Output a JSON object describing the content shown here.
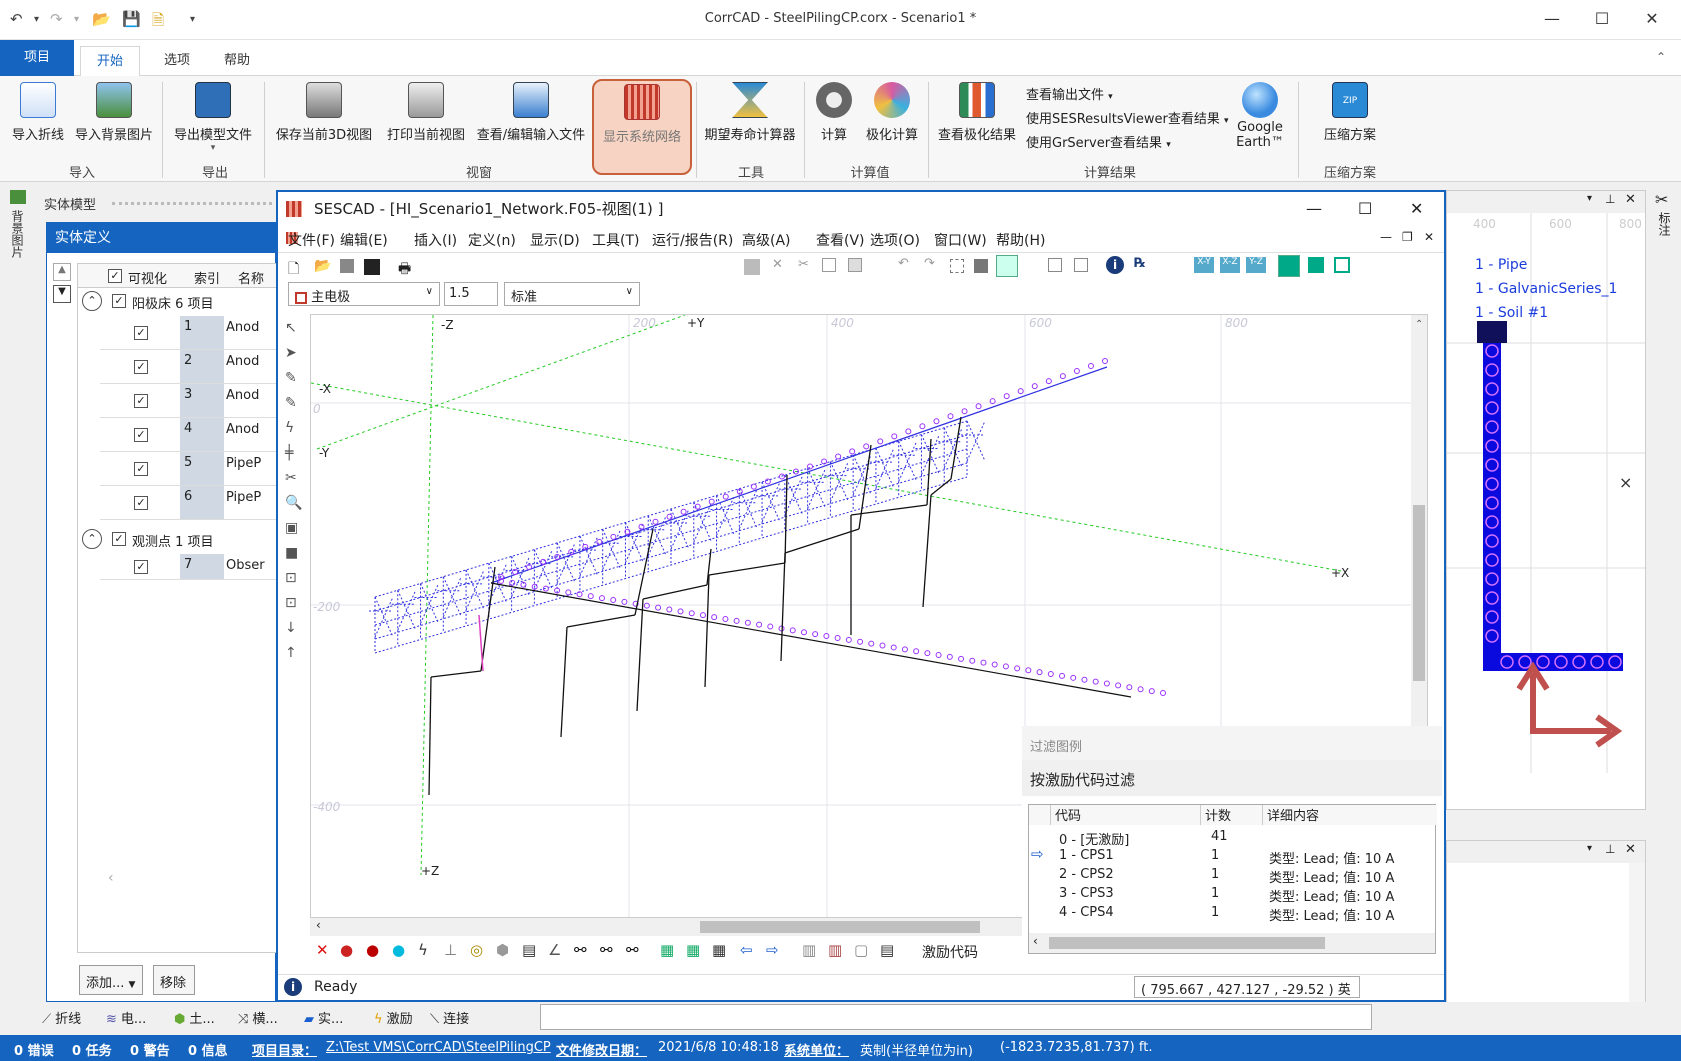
{
  "app": {
    "title": "CorrCAD - SteelPilingCP.corx - Scenario1 *",
    "qa_icons": [
      "undo-icon",
      "redo-icon",
      "open-icon",
      "save-icon",
      "saveas-icon",
      "customize-icon"
    ]
  },
  "tabs": [
    "项目",
    "开始",
    "选项",
    "帮助"
  ],
  "ribbon": {
    "buttons": [
      {
        "label": "导入折线",
        "icon": "import-polyline-icon",
        "color": "#3b7bd4"
      },
      {
        "label": "导入背景图片",
        "icon": "import-image-icon",
        "color": "#4a8f3c"
      },
      {
        "label": "导出模型文件",
        "icon": "export-model-icon",
        "color": "#2f6fb8"
      },
      {
        "label": "保存当前3D视图",
        "icon": "camera-icon",
        "color": "#666666"
      },
      {
        "label": "打印当前视图",
        "icon": "printer-icon",
        "color": "#777777"
      },
      {
        "label": "查看/编辑输入文件",
        "icon": "edit-file-icon",
        "color": "#3a7fd0"
      },
      {
        "label": "显示系统网络",
        "icon": "network-icon",
        "color": "#c0392b"
      },
      {
        "label": "期望寿命计算器",
        "icon": "hourglass-icon",
        "color": "#2a8ad6"
      },
      {
        "label": "计算",
        "icon": "gear-icon",
        "color": "#666666"
      },
      {
        "label": "极化计算",
        "icon": "polarize-icon",
        "color": "#d85aa0"
      },
      {
        "label": "查看极化结果",
        "icon": "chart-icon",
        "color": "#2e8b57"
      },
      {
        "label": "Google",
        "label2": "Earth™",
        "icon": "google-earth-icon",
        "color": "#3a8be0"
      },
      {
        "label": "压缩方案",
        "icon": "zip-icon",
        "color": "#2a8ad6"
      }
    ],
    "small": [
      "查看输出文件",
      "使用SESResultsViewer查看结果",
      "使用GrServer查看结果"
    ],
    "groups": [
      "导入",
      "导出",
      "视窗",
      "工具",
      "计算值",
      "计算结果",
      "压缩方案"
    ]
  },
  "entity": {
    "panel_title": "实体模型",
    "def_title": "实体定义",
    "cols": [
      "可视化",
      "索引",
      "名称"
    ],
    "group1": "阳极床 6 项目",
    "group2": "观测点 1 项目",
    "rows": [
      {
        "idx": "1",
        "name": "Anod"
      },
      {
        "idx": "2",
        "name": "Anod"
      },
      {
        "idx": "3",
        "name": "Anod"
      },
      {
        "idx": "4",
        "name": "Anod"
      },
      {
        "idx": "5",
        "name": "PipeP"
      },
      {
        "idx": "6",
        "name": "PipeP"
      }
    ],
    "obs": {
      "idx": "7",
      "name": "Obser"
    },
    "add": "添加...",
    "remove": "移除",
    "side_label": "背景图片"
  },
  "sescad": {
    "title": "SESCAD - [HI_Scenario1_Network.F05-视图(1) ]",
    "menu": [
      "文件(F)",
      "编辑(E)",
      "插入(I)",
      "定义(n)",
      "显示(D)",
      "工具(T)",
      "运行/报告(R)",
      "高级(A)",
      "查看(V)",
      "选项(O)",
      "窗口(W)",
      "帮助(H)"
    ],
    "electrode": "主电极",
    "value": "1.5",
    "mode": "标准",
    "axis_labels": [
      "-Z",
      "+Y",
      "-X",
      "-Y",
      "+X",
      "+Z",
      "0"
    ],
    "ticks_x": [
      "200",
      "400",
      "600",
      "800"
    ],
    "ticks_y": [
      "-200",
      "-400"
    ],
    "status_ready": "Ready",
    "coords": "( 795.667  , 427.127  ,  -29.52   ) 英",
    "excite_code": "激励代码"
  },
  "legend": {
    "head": "过滤图例",
    "bar": "按激励代码过滤",
    "cols": [
      "代码",
      "计数",
      "详细内容"
    ],
    "rows": [
      {
        "code": "0 - [无激励]",
        "count": "41",
        "detail": ""
      },
      {
        "code": "1 - CPS1",
        "count": "1",
        "detail": "类型: Lead; 值: 10 A"
      },
      {
        "code": "2 - CPS2",
        "count": "1",
        "detail": "类型: Lead; 值: 10 A"
      },
      {
        "code": "3 - CPS3",
        "count": "1",
        "detail": "类型: Lead; 值: 10 A"
      },
      {
        "code": "4 - CPS4",
        "count": "1",
        "detail": "类型: Lead; 值: 10 A"
      }
    ]
  },
  "right": {
    "items": [
      "1 - Pipe",
      "1 - GalvanicSeries_1",
      "1 - Soil #1"
    ],
    "ticks": [
      "400",
      "600",
      "800"
    ],
    "side_label": "标注"
  },
  "bottom_tabs": [
    "折线",
    "电...",
    "土...",
    "横...",
    "实...",
    "激励",
    "连接"
  ],
  "statusbar": {
    "errors": "0 错误",
    "tasks": "0 任务",
    "warnings": "0 警告",
    "info": "0 信息",
    "dir_label": "项目目录：",
    "dir": "Z:\\Test VMS\\CorrCAD\\SteelPilingCP",
    "date_label": "文件修改日期：",
    "date": "2021/6/8 10:48:18",
    "unit_label": "系统单位：",
    "unit": "英制(半径单位为in)",
    "coord": "(-1823.7235,81.737) ft."
  },
  "colors": {
    "accent": "#1565c0",
    "mesh": "#3030e0",
    "magenta": "#9b30ff",
    "axis": "#22cc22"
  }
}
